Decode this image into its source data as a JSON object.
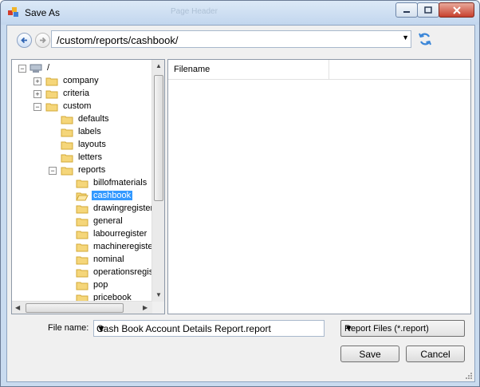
{
  "window": {
    "title": "Save As",
    "background_tabs": [
      "Page Header"
    ],
    "accent": "#3399ff"
  },
  "toolbar": {
    "back_icon": "back-arrow-icon",
    "forward_icon": "forward-arrow-icon",
    "path": "/custom/reports/cashbook/",
    "refresh_icon": "refresh-icon"
  },
  "tree": {
    "root": "/",
    "nodes": [
      {
        "label": "company",
        "expander": "+"
      },
      {
        "label": "criteria",
        "expander": "+"
      },
      {
        "label": "custom",
        "expander": "-"
      },
      {
        "label": "defaults"
      },
      {
        "label": "labels"
      },
      {
        "label": "layouts"
      },
      {
        "label": "letters"
      },
      {
        "label": "reports",
        "expander": "-"
      },
      {
        "label": "billofmaterials"
      },
      {
        "label": "cashbook",
        "selected": true
      },
      {
        "label": "drawingregister"
      },
      {
        "label": "general"
      },
      {
        "label": "labourregister"
      },
      {
        "label": "machineregister"
      },
      {
        "label": "nominal"
      },
      {
        "label": "operationsregister"
      },
      {
        "label": "pop"
      },
      {
        "label": "pricebook"
      }
    ]
  },
  "list": {
    "columns": [
      "Filename",
      ""
    ]
  },
  "footer": {
    "file_name_label": "File name:",
    "file_name_value": "Cash Book Account Details Report.report",
    "filter_value": "Report Files (*.report)",
    "save_label": "Save",
    "cancel_label": "Cancel"
  }
}
